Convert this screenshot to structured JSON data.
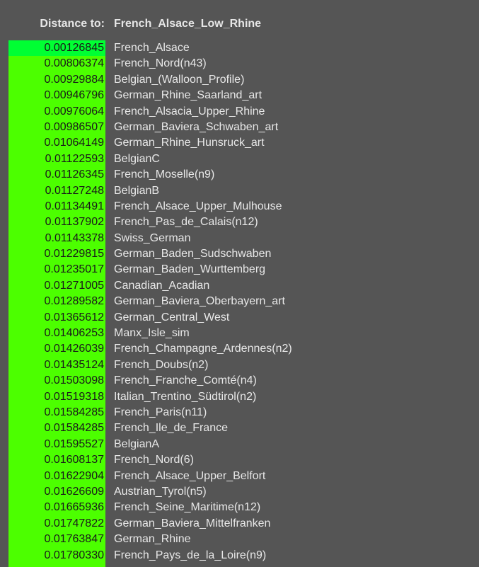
{
  "header": {
    "label": "Distance to:",
    "target": "French_Alsace_Low_Rhine"
  },
  "colors": {
    "background": "#555555",
    "bar_nearest": "#00ff33",
    "bar_default": "#4cff00",
    "value_text": "#1a1a1a",
    "name_text": "#e8e8e8",
    "header_text": "#e6e6e6"
  },
  "rows": [
    {
      "value": "0.00126845",
      "name": "French_Alsace"
    },
    {
      "value": "0.00806374",
      "name": "French_Nord(n43)"
    },
    {
      "value": "0.00929884",
      "name": "Belgian_(Walloon_Profile)"
    },
    {
      "value": "0.00946796",
      "name": "German_Rhine_Saarland_art"
    },
    {
      "value": "0.00976064",
      "name": "French_Alsacia_Upper_Rhine"
    },
    {
      "value": "0.00986507",
      "name": "German_Baviera_Schwaben_art"
    },
    {
      "value": "0.01064149",
      "name": "German_Rhine_Hunsruck_art"
    },
    {
      "value": "0.01122593",
      "name": "BelgianC"
    },
    {
      "value": "0.01126345",
      "name": "French_Moselle(n9)"
    },
    {
      "value": "0.01127248",
      "name": "BelgianB"
    },
    {
      "value": "0.01134491",
      "name": "French_Alsace_Upper_Mulhouse"
    },
    {
      "value": "0.01137902",
      "name": "French_Pas_de_Calais(n12)"
    },
    {
      "value": "0.01143378",
      "name": "Swiss_German"
    },
    {
      "value": "0.01229815",
      "name": "German_Baden_Sudschwaben"
    },
    {
      "value": "0.01235017",
      "name": "German_Baden_Wurttemberg"
    },
    {
      "value": "0.01271005",
      "name": "Canadian_Acadian"
    },
    {
      "value": "0.01289582",
      "name": "German_Baviera_Oberbayern_art"
    },
    {
      "value": "0.01365612",
      "name": "German_Central_West"
    },
    {
      "value": "0.01406253",
      "name": "Manx_Isle_sim"
    },
    {
      "value": "0.01426039",
      "name": "French_Champagne_Ardennes(n2)"
    },
    {
      "value": "0.01435124",
      "name": "French_Doubs(n2)"
    },
    {
      "value": "0.01503098",
      "name": "French_Franche_Comté(n4)"
    },
    {
      "value": "0.01519318",
      "name": "Italian_Trentino_Südtirol(n2)"
    },
    {
      "value": "0.01584285",
      "name": "French_Paris(n11)"
    },
    {
      "value": "0.01584285",
      "name": "French_Ile_de_France"
    },
    {
      "value": "0.01595527",
      "name": "BelgianA"
    },
    {
      "value": "0.01608137",
      "name": "French_Nord(6)"
    },
    {
      "value": "0.01622904",
      "name": "French_Alsace_Upper_Belfort"
    },
    {
      "value": "0.01626609",
      "name": "Austrian_Tyrol(n5)"
    },
    {
      "value": "0.01665936",
      "name": "French_Seine_Maritime(n12)"
    },
    {
      "value": "0.01747822",
      "name": "German_Baviera_Mittelfranken"
    },
    {
      "value": "0.01763847",
      "name": "German_Rhine"
    },
    {
      "value": "0.01780330",
      "name": "French_Pays_de_la_Loire(n9)"
    }
  ]
}
